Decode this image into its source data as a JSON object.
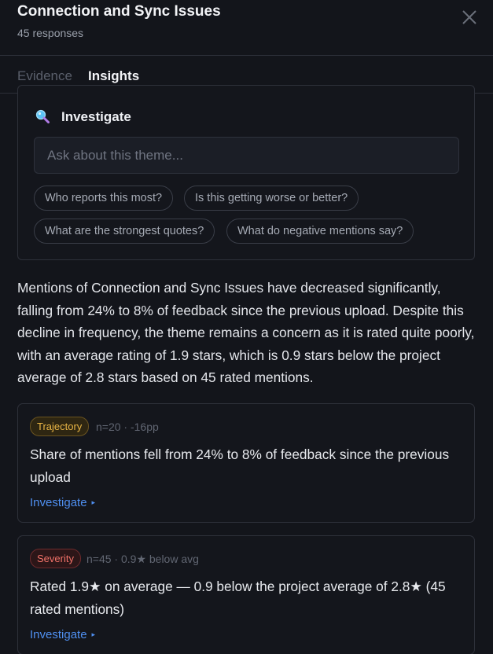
{
  "header": {
    "title": "Connection and Sync Issues",
    "subtitle": "45 responses",
    "close_icon": "close-icon"
  },
  "tabs": [
    {
      "label": "Evidence",
      "active": false
    },
    {
      "label": "Insights",
      "active": true
    }
  ],
  "investigate": {
    "icon": "magnifier-icon",
    "heading": "Investigate",
    "placeholder": "Ask about this theme...",
    "value": "",
    "suggestions": [
      "Who reports this most?",
      "Is this getting worse or better?",
      "What are the strongest quotes?",
      "What do negative mentions say?"
    ]
  },
  "summary": "Mentions of Connection and Sync Issues have decreased significantly, falling from 24% to 8% of feedback since the previous upload. Despite this decline in frequency, the theme remains a concern as it is rated quite poorly, with an average rating of 1.9 stars, which is 0.9 stars below the project average of 2.8 stars based on 45 rated mentions.",
  "cards": [
    {
      "badge": "Trajectory",
      "meta": "n=20 · -16pp",
      "text": "Share of mentions fell from 24% to 8% of feedback since the previous upload",
      "link": "Investigate",
      "arrow": "▸"
    },
    {
      "badge": "Severity",
      "meta": "n=45 · 0.9★ below avg",
      "text": "Rated 1.9★ on average — 0.9 below the project average of 2.8★ (45 rated mentions)",
      "link": "Investigate",
      "arrow": "▸"
    }
  ],
  "colors": {
    "background": "#13151b",
    "accent": "#4e8df5",
    "trajectory": "#e8b545",
    "severity": "#f07168"
  }
}
